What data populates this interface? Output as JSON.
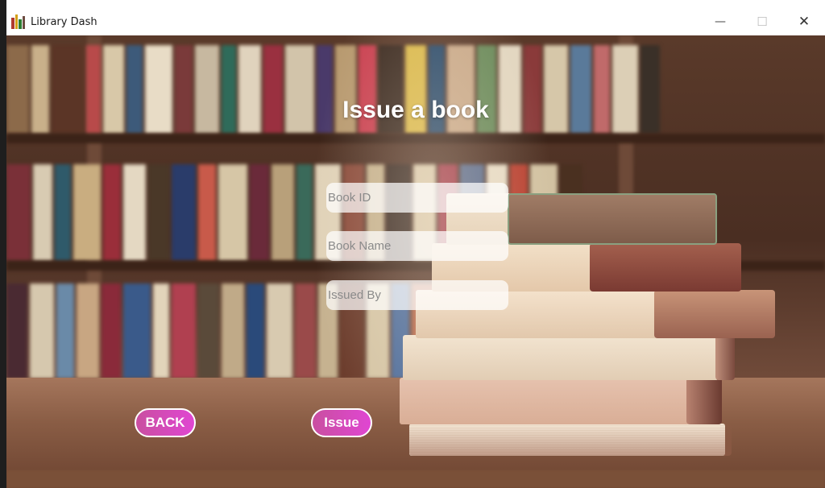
{
  "window": {
    "title": "Library Dash",
    "controls": {
      "minimize": "—",
      "maximize": "☐",
      "close": "✕"
    }
  },
  "page": {
    "heading": "Issue a book"
  },
  "form": {
    "book_id_placeholder": "Book ID",
    "book_name_placeholder": "Book Name",
    "issued_by_placeholder": "Issued By",
    "book_id_value": "",
    "book_name_value": "",
    "issued_by_value": ""
  },
  "buttons": {
    "back_label": "BACK",
    "issue_label": "Issue"
  },
  "colors": {
    "button_gradient_start": "#c94fa0",
    "button_gradient_end": "#e046d2",
    "field_background": "rgba(255,255,255,0.72)"
  },
  "icons": {
    "app_icon": "books-icon"
  }
}
